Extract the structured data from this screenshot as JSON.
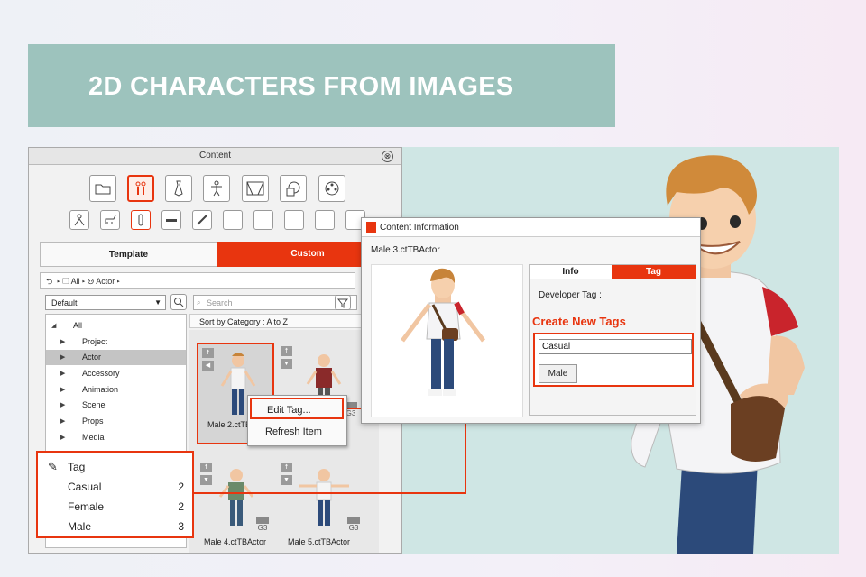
{
  "banner": {
    "title": "2D CHARACTERS FROM IMAGES"
  },
  "content_panel": {
    "title": "Content",
    "close_glyph": "⊗",
    "top_icons": [
      "folder-icon",
      "actor-icon",
      "tie-icon",
      "body-icon",
      "stage-icon",
      "props-icon",
      "film-reel-icon"
    ],
    "sub_icons": [
      "pose-icon",
      "animal-icon",
      "bone-icon",
      "slider-icon",
      "pen-icon"
    ],
    "tabs": {
      "template": "Template",
      "custom": "Custom"
    },
    "breadcrumb": {
      "all": "All",
      "actor": "Actor"
    },
    "dropdown": {
      "value": "Default"
    },
    "search": {
      "placeholder": "Search"
    },
    "sort": "Sort by Category : A to Z",
    "tree": [
      {
        "label": "All"
      },
      {
        "label": "Project"
      },
      {
        "label": "Actor"
      },
      {
        "label": "Accessory"
      },
      {
        "label": "Animation"
      },
      {
        "label": "Scene"
      },
      {
        "label": "Props"
      },
      {
        "label": "Media"
      }
    ],
    "thumbs": [
      {
        "label": "Male 2.ctTBAct",
        "badge": ""
      },
      {
        "label": "",
        "badge": "G3"
      },
      {
        "label": "Male 4.ctTBActor",
        "badge": "G3"
      },
      {
        "label": "Male 5.ctTBActor",
        "badge": "G3"
      }
    ]
  },
  "context_menu": {
    "edit": "Edit Tag...",
    "refresh": "Refresh Item"
  },
  "tag_box": {
    "title": "Tag",
    "rows": [
      {
        "name": "Casual",
        "count": "2"
      },
      {
        "name": "Female",
        "count": "2"
      },
      {
        "name": "Male",
        "count": "3"
      }
    ]
  },
  "info_window": {
    "title": "Content Information",
    "file": "Male 3.ctTBActor",
    "tabs": {
      "info": "Info",
      "tag": "Tag"
    },
    "developer_tag": "Developer Tag :",
    "create_heading": "Create New Tags",
    "input_value": "Casual",
    "tag_button": "Male"
  },
  "colors": {
    "accent": "#e8350f",
    "banner": "#9dc3bd",
    "stage": "#cfe6e4"
  }
}
